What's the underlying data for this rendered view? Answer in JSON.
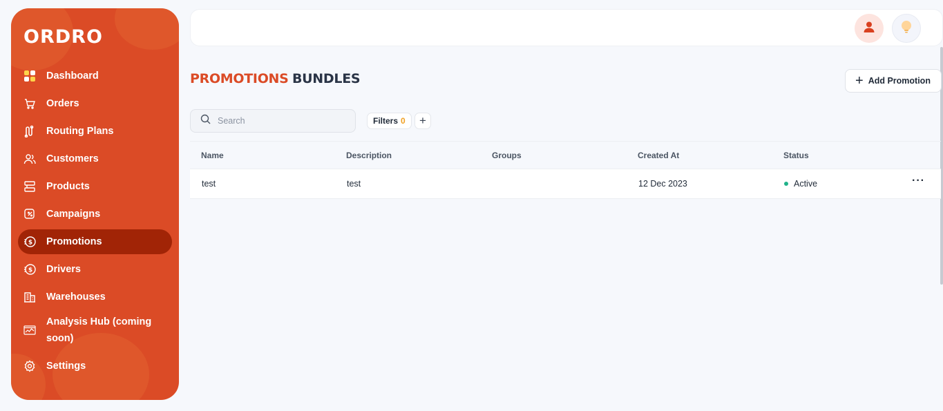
{
  "brand": {
    "logo_text": "ORDRO",
    "primary_color": "#db4b26",
    "active_color": "#a12406"
  },
  "sidebar": {
    "items": [
      {
        "label": "Dashboard",
        "icon": "dashboard-icon"
      },
      {
        "label": "Orders",
        "icon": "cart-icon"
      },
      {
        "label": "Routing Plans",
        "icon": "route-icon"
      },
      {
        "label": "Customers",
        "icon": "users-icon"
      },
      {
        "label": "Products",
        "icon": "products-icon"
      },
      {
        "label": "Campaigns",
        "icon": "campaign-icon"
      },
      {
        "label": "Promotions",
        "icon": "coin-icon",
        "active": true
      },
      {
        "label": "Drivers",
        "icon": "coin-icon"
      },
      {
        "label": "Warehouses",
        "icon": "building-icon"
      },
      {
        "label": "Analysis Hub (coming soon)",
        "icon": "chart-icon"
      },
      {
        "label": "Settings",
        "icon": "gear-icon"
      }
    ]
  },
  "header": {
    "user_icon": "user-icon",
    "theme_icon": "lightbulb-icon"
  },
  "tabs": [
    {
      "label": "PROMOTIONS",
      "active": true
    },
    {
      "label": "BUNDLES",
      "active": false
    }
  ],
  "toolbar": {
    "add_label": "Add Promotion",
    "search_placeholder": "Search",
    "filters_label": "Filters",
    "filters_count": "0"
  },
  "table": {
    "columns": [
      "Name",
      "Description",
      "Groups",
      "Created At",
      "Status"
    ],
    "rows": [
      {
        "name": "test",
        "description": "test",
        "groups": "",
        "created_at": "12 Dec 2023",
        "status": "Active"
      }
    ]
  }
}
